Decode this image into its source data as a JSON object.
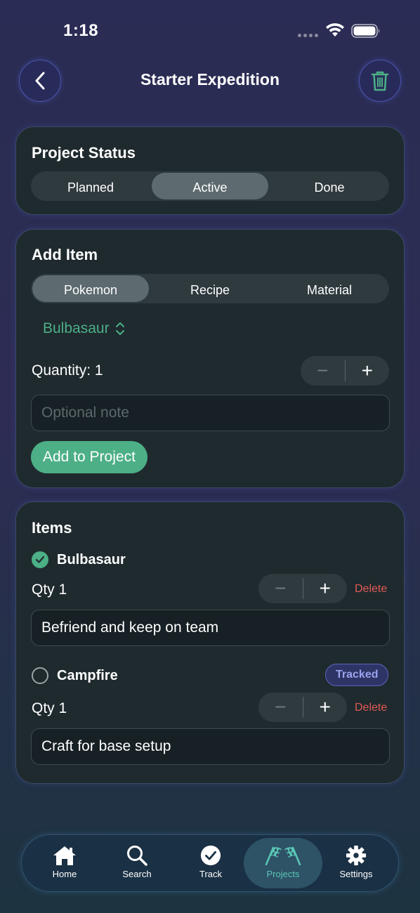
{
  "status_bar": {
    "time": "1:18"
  },
  "nav": {
    "title": "Starter Expedition"
  },
  "status_card": {
    "title": "Project Status",
    "options": [
      "Planned",
      "Active",
      "Done"
    ],
    "selected": "Active"
  },
  "add_item_card": {
    "title": "Add Item",
    "types": [
      "Pokemon",
      "Recipe",
      "Material"
    ],
    "selected_type": "Pokemon",
    "picker_value": "Bulbasaur",
    "quantity_label": "Quantity: 1",
    "note_placeholder": "Optional note",
    "add_button": "Add to Project"
  },
  "items_card": {
    "title": "Items",
    "items": [
      {
        "name": "Bulbasaur",
        "checked": true,
        "qty": "Qty 1",
        "delete": "Delete",
        "note": "Befriend and keep on team",
        "badge": ""
      },
      {
        "name": "Campfire",
        "checked": false,
        "qty": "Qty 1",
        "delete": "Delete",
        "note": "Craft for base setup",
        "badge": "Tracked"
      }
    ]
  },
  "tabbar": {
    "tabs": [
      {
        "label": "Home",
        "icon": "house-icon"
      },
      {
        "label": "Search",
        "icon": "magnifier-icon"
      },
      {
        "label": "Track",
        "icon": "checkmark-circle-icon"
      },
      {
        "label": "Projects",
        "icon": "checkered-flags-icon"
      },
      {
        "label": "Settings",
        "icon": "gear-icon"
      }
    ],
    "active": "Projects"
  },
  "colors": {
    "accent_green": "#4caf86",
    "delete_red": "#e05a55",
    "tracked_purple": "#9aa2ee",
    "active_tab": "#5ac6b6"
  }
}
